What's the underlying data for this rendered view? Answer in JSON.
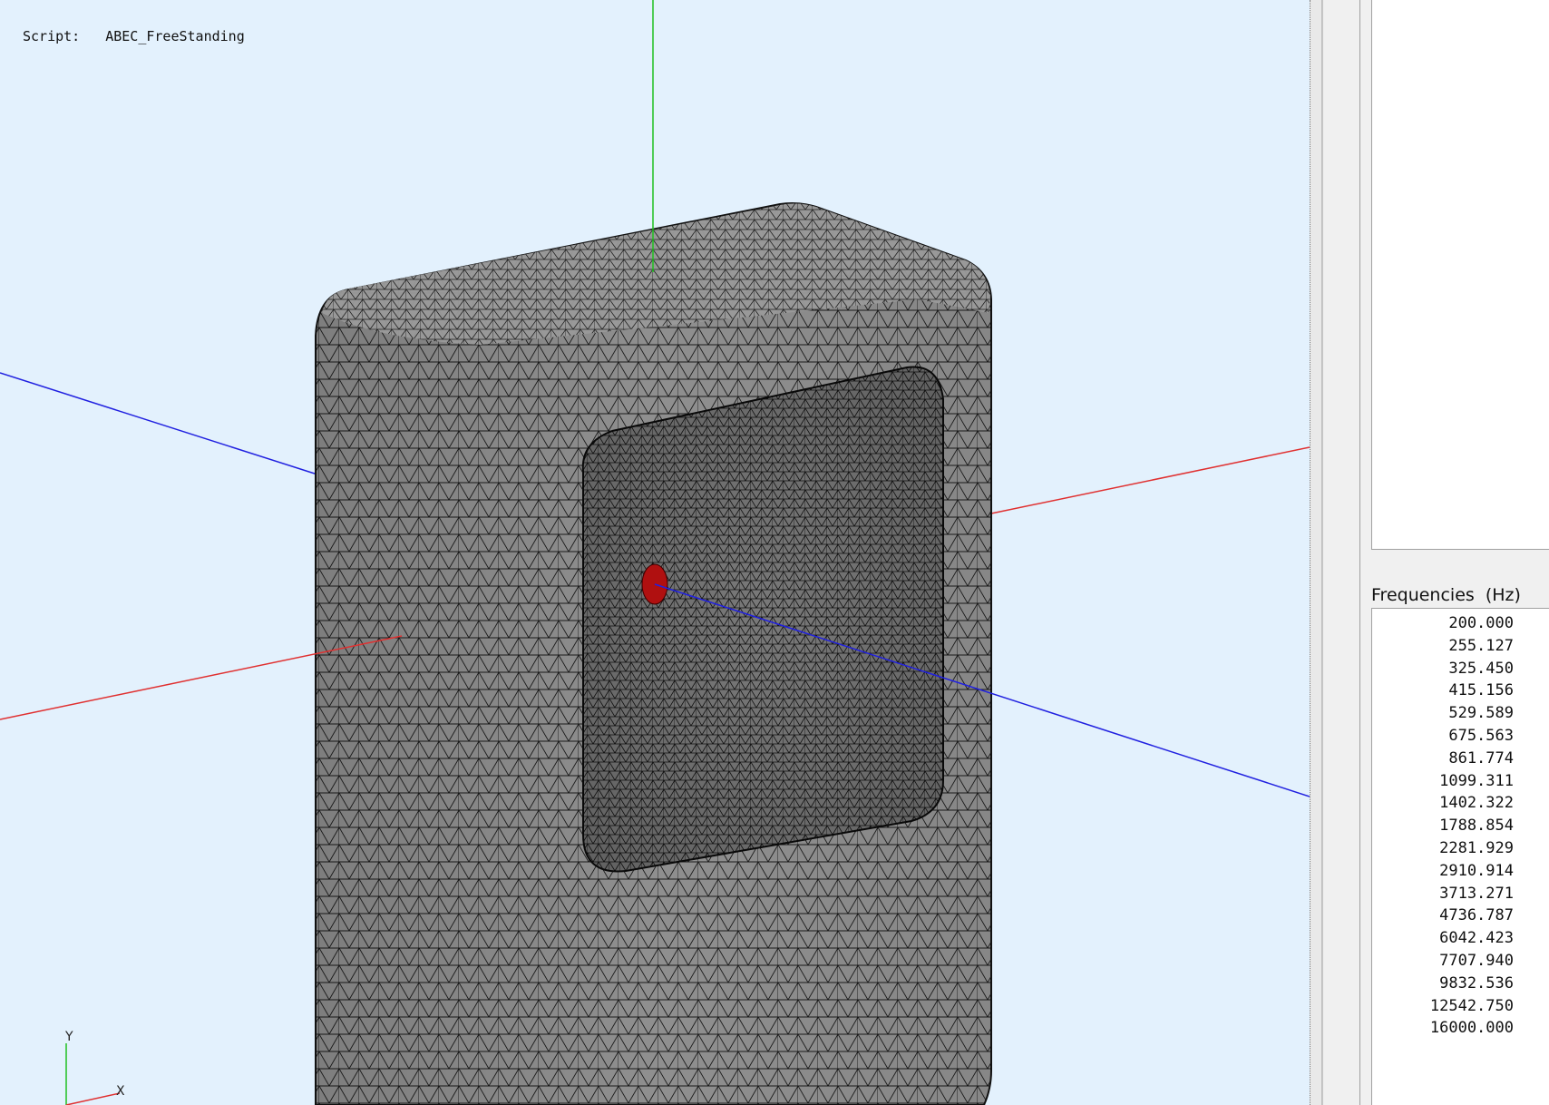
{
  "viewport": {
    "script_label": "Script:",
    "script_name": "ABEC_FreeStanding",
    "background_color": "#e3f1fd",
    "mesh_color": "#8f8f8f",
    "mesh_line_color": "#1a1a1a",
    "source_color": "#b01010",
    "axes": {
      "x_color": "#e03030",
      "y_color": "#20c020",
      "z_color": "#2020e0"
    },
    "triad": {
      "y_label": "Y",
      "x_label": "X"
    }
  },
  "frequencies": {
    "title": "Frequencies  (Hz)",
    "values": [
      "200.000",
      "255.127",
      "325.450",
      "415.156",
      "529.589",
      "675.563",
      "861.774",
      "1099.311",
      "1402.322",
      "1788.854",
      "2281.929",
      "2910.914",
      "3713.271",
      "4736.787",
      "6042.423",
      "7707.940",
      "9832.536",
      "12542.750",
      "16000.000"
    ]
  }
}
